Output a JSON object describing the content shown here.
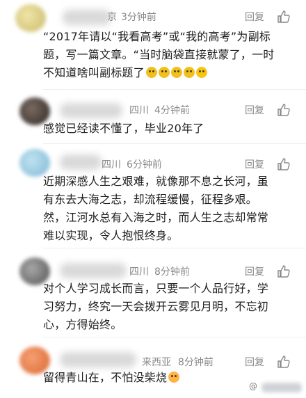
{
  "comments": [
    {
      "location": "",
      "location_partial": "京",
      "time": "3分钟前",
      "reply": "回复",
      "lines": [
        "“2017年请以“我看高考”或“我的高考”为副标",
        "题，写一篇文章。“当时脑袋直接就蒙了，一时",
        "不知道啥叫副标题了"
      ],
      "emoji_count": 5
    },
    {
      "location": "四川",
      "time": "4分钟前",
      "reply": "回复",
      "lines": [
        "感觉已经读不懂了，毕业20年了"
      ]
    },
    {
      "location": "四川",
      "time": "6分钟前",
      "reply": "回复",
      "lines": [
        "近期深感人生之艰难，就像那不息之长河，虽",
        "有东去大海之志，却流程缓慢，征程多艰。",
        "然，江河水总有入海之时，而人生之志却常常",
        "难以实现，令人抱恨终身。"
      ]
    },
    {
      "location": "四川",
      "time": "8分钟前",
      "reply": "回复",
      "lines": [
        "对个人学习成长而言，只要一个人品行好，学",
        "习努力，终究一天会拨开云雾见月明，不忘初",
        "心，方得始终。"
      ]
    },
    {
      "location": "来西亚",
      "time": "8分钟前",
      "reply": "回复",
      "lines": [
        "留得青山在，不怕没柴烧"
      ]
    }
  ],
  "watermark": "@"
}
